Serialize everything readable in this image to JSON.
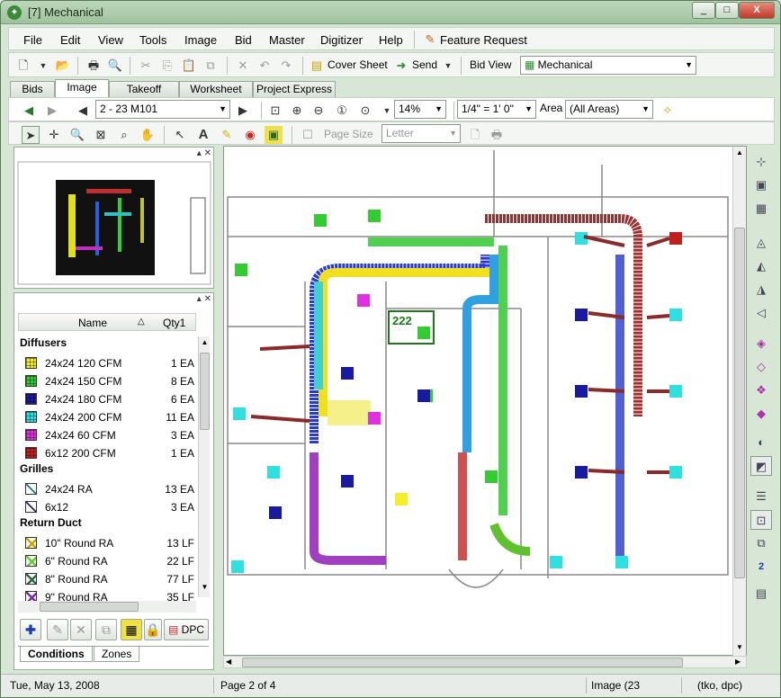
{
  "window": {
    "title": "[7] Mechanical",
    "controls": [
      "_",
      "□",
      "X"
    ]
  },
  "menus": [
    "File",
    "Edit",
    "View",
    "Tools",
    "Image",
    "Bid",
    "Master",
    "Digitizer",
    "Help"
  ],
  "menu_feature": "Feature Request",
  "toolbar1": {
    "cover_sheet": "Cover Sheet",
    "send": "Send",
    "bid_view_label": "Bid View",
    "bid_view_value": "Mechanical"
  },
  "tabs": [
    "Bids",
    "Image",
    "Takeoff",
    "Worksheet",
    "Project Express"
  ],
  "active_tab": "Image",
  "toolbar2": {
    "page": "2 - 23 M101",
    "zoom": "14%",
    "scale": "1/4\" = 1' 0\"",
    "area_label": "Area",
    "area_value": "(All Areas)"
  },
  "toolbar3": {
    "page_size_label": "Page Size",
    "page_size_value": "Letter"
  },
  "conditions": {
    "col_name": "Name",
    "col_qty": "Qty1",
    "sections": [
      {
        "title": "Diffusers",
        "items": [
          {
            "name": "24x24 120 CFM",
            "qty": "1 EA",
            "color": "#f5ee2a",
            "pattern": "grid"
          },
          {
            "name": "24x24 150 CFM",
            "qty": "8 EA",
            "color": "#33cc33",
            "pattern": "grid"
          },
          {
            "name": "24x24 180 CFM",
            "qty": "6 EA",
            "color": "#1a1aa0",
            "pattern": "grid"
          },
          {
            "name": "24x24 200 CFM",
            "qty": "11 EA",
            "color": "#2ee0e0",
            "pattern": "grid"
          },
          {
            "name": "24x24 60 CFM",
            "qty": "3 EA",
            "color": "#e030e0",
            "pattern": "grid"
          },
          {
            "name": "6x12 200 CFM",
            "qty": "1 EA",
            "color": "#c02020",
            "pattern": "grid"
          }
        ]
      },
      {
        "title": "Grilles",
        "items": [
          {
            "name": "24x24 RA",
            "qty": "13 EA",
            "color": "#1a7a8a",
            "pattern": "diag"
          },
          {
            "name": "6x12",
            "qty": "3 EA",
            "color": "#222266",
            "pattern": "diag"
          }
        ]
      },
      {
        "title": "Return Duct",
        "items": [
          {
            "name": "10\" Round RA",
            "qty": "13 LF",
            "color": "#c8a800",
            "pattern": "cross"
          },
          {
            "name": "6\" Round RA",
            "qty": "22 LF",
            "color": "#66cc33",
            "pattern": "cross"
          },
          {
            "name": "8\" Round RA",
            "qty": "77 LF",
            "color": "#2a6a3a",
            "pattern": "cross"
          },
          {
            "name": "9\" Round RA",
            "qty": "35 LF",
            "color": "#7a2a9a",
            "pattern": "cross"
          }
        ]
      }
    ],
    "dpc_button": "DPC",
    "bottom_tabs": [
      "Conditions",
      "Zones"
    ]
  },
  "canvas": {
    "room_number": "222"
  },
  "status": {
    "date": "Tue, May 13, 2008",
    "page": "Page 2 of 4",
    "image": "Image (23",
    "user": "(tko, dpc)"
  }
}
